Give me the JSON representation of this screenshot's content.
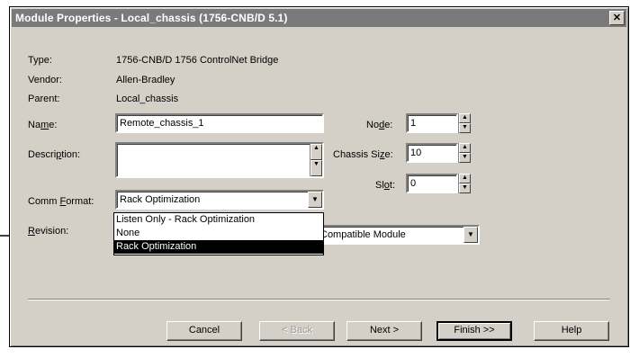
{
  "window": {
    "title": "Module Properties - Local_chassis (1756-CNB/D 5.1)",
    "close_glyph": "✕"
  },
  "info": {
    "type_label": "Type:",
    "type_value": "1756-CNB/D 1756 ControlNet Bridge",
    "vendor_label": "Vendor:",
    "vendor_value": "Allen-Bradley",
    "parent_label": "Parent:",
    "parent_value": "Local_chassis"
  },
  "name": {
    "label_pre": "Na",
    "label_ul": "m",
    "label_post": "e:",
    "value": "Remote_chassis_1"
  },
  "description": {
    "label_pre": "Descri",
    "label_ul": "p",
    "label_post": "tion:",
    "value": ""
  },
  "comm_format": {
    "label_pre": "Comm ",
    "label_ul": "F",
    "label_post": "ormat:",
    "value": "Rack Optimization",
    "options": [
      "Listen Only - Rack Optimization",
      "None",
      "Rack Optimization"
    ],
    "selected_index": 2
  },
  "revision": {
    "label_pre": "",
    "label_ul": "R",
    "label_post": "evision:",
    "keying_value": "Compatible Module"
  },
  "node": {
    "label_pre": "No",
    "label_ul": "d",
    "label_post": "e:",
    "value": "1"
  },
  "chassis_size": {
    "label_pre": "Chassis Si",
    "label_ul": "z",
    "label_post": "e:",
    "value": "10"
  },
  "slot": {
    "label_pre": "Sl",
    "label_ul": "o",
    "label_post": "t:",
    "value": "0"
  },
  "buttons": {
    "cancel": "Cancel",
    "back": "< Back",
    "next": "Next >",
    "finish": "Finish >>",
    "help": "Help"
  },
  "icons": {
    "spin_up": "▲",
    "spin_down": "▼",
    "dropdown": "▼"
  },
  "colors": {
    "dialog_bg": "#d4d0c8",
    "titlebar": "#7a7a7a",
    "selection": "#000000"
  }
}
